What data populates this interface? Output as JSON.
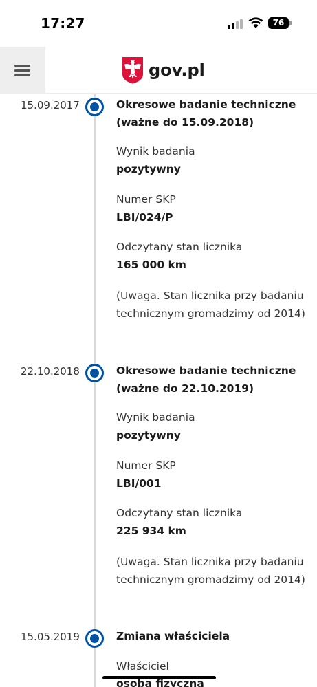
{
  "status_bar": {
    "time": "17:27",
    "battery": "76"
  },
  "header": {
    "brand": "gov.pl",
    "menu_icon": "hamburger-icon",
    "emblem_icon": "polish-eagle-emblem"
  },
  "colors": {
    "accent": "#0052a5",
    "timeline_line": "#d9d9d9",
    "menu_bg": "#eeeeee",
    "emblem_red": "#dc143c"
  },
  "entries": [
    {
      "date": "15.09.2017",
      "title": "Okresowe badanie techniczne (ważne do 15.09.2018)",
      "result_label": "Wynik badania",
      "result_value": "pozytywny",
      "skp_label": "Numer SKP",
      "skp_value": "LBI/024/P",
      "odometer_label": "Odczytany stan licznika",
      "odometer_value": "165 000 km",
      "note": "(Uwaga. Stan licznika przy badaniu technicznym gromadzimy od 2014)"
    },
    {
      "date": "22.10.2018",
      "title": "Okresowe badanie techniczne (ważne do 22.10.2019)",
      "result_label": "Wynik badania",
      "result_value": "pozytywny",
      "skp_label": "Numer SKP",
      "skp_value": "LBI/001",
      "odometer_label": "Odczytany stan licznika",
      "odometer_value": "225 934 km",
      "note": "(Uwaga. Stan licznika przy badaniu technicznym gromadzimy od 2014)"
    },
    {
      "date": "15.05.2019",
      "title": "Zmiana właściciela",
      "owner_label": "Właściciel",
      "owner_value": "osoba fizyczna"
    }
  ]
}
